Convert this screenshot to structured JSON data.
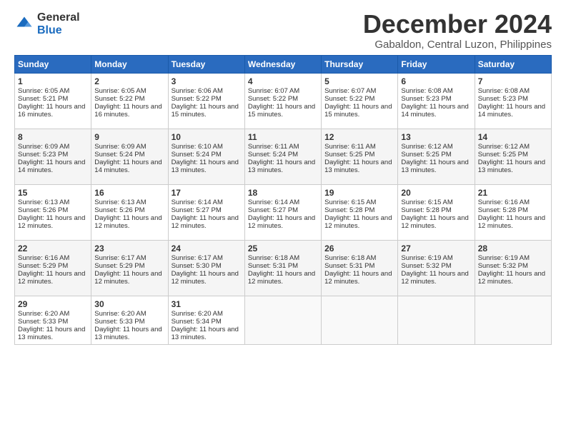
{
  "logo": {
    "general": "General",
    "blue": "Blue"
  },
  "header": {
    "month": "December 2024",
    "location": "Gabaldon, Central Luzon, Philippines"
  },
  "days_of_week": [
    "Sunday",
    "Monday",
    "Tuesday",
    "Wednesday",
    "Thursday",
    "Friday",
    "Saturday"
  ],
  "weeks": [
    [
      {
        "day": "1",
        "sunrise": "6:05 AM",
        "sunset": "5:21 PM",
        "daylight": "11 hours and 16 minutes."
      },
      {
        "day": "2",
        "sunrise": "6:05 AM",
        "sunset": "5:22 PM",
        "daylight": "11 hours and 16 minutes."
      },
      {
        "day": "3",
        "sunrise": "6:06 AM",
        "sunset": "5:22 PM",
        "daylight": "11 hours and 15 minutes."
      },
      {
        "day": "4",
        "sunrise": "6:07 AM",
        "sunset": "5:22 PM",
        "daylight": "11 hours and 15 minutes."
      },
      {
        "day": "5",
        "sunrise": "6:07 AM",
        "sunset": "5:22 PM",
        "daylight": "11 hours and 15 minutes."
      },
      {
        "day": "6",
        "sunrise": "6:08 AM",
        "sunset": "5:23 PM",
        "daylight": "11 hours and 14 minutes."
      },
      {
        "day": "7",
        "sunrise": "6:08 AM",
        "sunset": "5:23 PM",
        "daylight": "11 hours and 14 minutes."
      }
    ],
    [
      {
        "day": "8",
        "sunrise": "6:09 AM",
        "sunset": "5:23 PM",
        "daylight": "11 hours and 14 minutes."
      },
      {
        "day": "9",
        "sunrise": "6:09 AM",
        "sunset": "5:24 PM",
        "daylight": "11 hours and 14 minutes."
      },
      {
        "day": "10",
        "sunrise": "6:10 AM",
        "sunset": "5:24 PM",
        "daylight": "11 hours and 13 minutes."
      },
      {
        "day": "11",
        "sunrise": "6:11 AM",
        "sunset": "5:24 PM",
        "daylight": "11 hours and 13 minutes."
      },
      {
        "day": "12",
        "sunrise": "6:11 AM",
        "sunset": "5:25 PM",
        "daylight": "11 hours and 13 minutes."
      },
      {
        "day": "13",
        "sunrise": "6:12 AM",
        "sunset": "5:25 PM",
        "daylight": "11 hours and 13 minutes."
      },
      {
        "day": "14",
        "sunrise": "6:12 AM",
        "sunset": "5:25 PM",
        "daylight": "11 hours and 13 minutes."
      }
    ],
    [
      {
        "day": "15",
        "sunrise": "6:13 AM",
        "sunset": "5:26 PM",
        "daylight": "11 hours and 12 minutes."
      },
      {
        "day": "16",
        "sunrise": "6:13 AM",
        "sunset": "5:26 PM",
        "daylight": "11 hours and 12 minutes."
      },
      {
        "day": "17",
        "sunrise": "6:14 AM",
        "sunset": "5:27 PM",
        "daylight": "11 hours and 12 minutes."
      },
      {
        "day": "18",
        "sunrise": "6:14 AM",
        "sunset": "5:27 PM",
        "daylight": "11 hours and 12 minutes."
      },
      {
        "day": "19",
        "sunrise": "6:15 AM",
        "sunset": "5:28 PM",
        "daylight": "11 hours and 12 minutes."
      },
      {
        "day": "20",
        "sunrise": "6:15 AM",
        "sunset": "5:28 PM",
        "daylight": "11 hours and 12 minutes."
      },
      {
        "day": "21",
        "sunrise": "6:16 AM",
        "sunset": "5:28 PM",
        "daylight": "11 hours and 12 minutes."
      }
    ],
    [
      {
        "day": "22",
        "sunrise": "6:16 AM",
        "sunset": "5:29 PM",
        "daylight": "11 hours and 12 minutes."
      },
      {
        "day": "23",
        "sunrise": "6:17 AM",
        "sunset": "5:29 PM",
        "daylight": "11 hours and 12 minutes."
      },
      {
        "day": "24",
        "sunrise": "6:17 AM",
        "sunset": "5:30 PM",
        "daylight": "11 hours and 12 minutes."
      },
      {
        "day": "25",
        "sunrise": "6:18 AM",
        "sunset": "5:31 PM",
        "daylight": "11 hours and 12 minutes."
      },
      {
        "day": "26",
        "sunrise": "6:18 AM",
        "sunset": "5:31 PM",
        "daylight": "11 hours and 12 minutes."
      },
      {
        "day": "27",
        "sunrise": "6:19 AM",
        "sunset": "5:32 PM",
        "daylight": "11 hours and 12 minutes."
      },
      {
        "day": "28",
        "sunrise": "6:19 AM",
        "sunset": "5:32 PM",
        "daylight": "11 hours and 12 minutes."
      }
    ],
    [
      {
        "day": "29",
        "sunrise": "6:20 AM",
        "sunset": "5:33 PM",
        "daylight": "11 hours and 13 minutes."
      },
      {
        "day": "30",
        "sunrise": "6:20 AM",
        "sunset": "5:33 PM",
        "daylight": "11 hours and 13 minutes."
      },
      {
        "day": "31",
        "sunrise": "6:20 AM",
        "sunset": "5:34 PM",
        "daylight": "11 hours and 13 minutes."
      },
      null,
      null,
      null,
      null
    ]
  ],
  "labels": {
    "sunrise": "Sunrise:",
    "sunset": "Sunset:",
    "daylight": "Daylight:"
  }
}
